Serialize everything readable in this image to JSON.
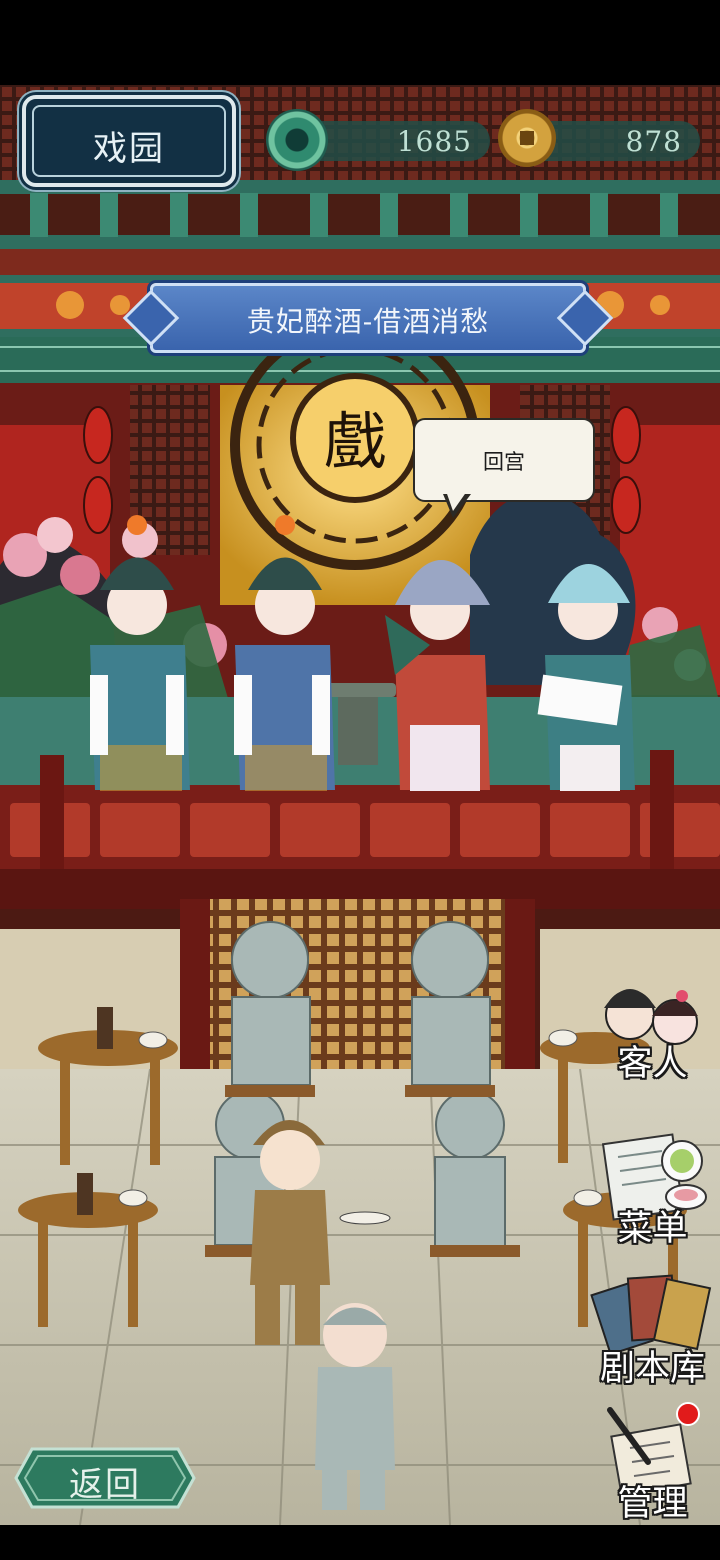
{
  "header": {
    "title": "戏园",
    "jade_amount": "1685",
    "coin_amount": "878"
  },
  "play_banner": "贵妃醉酒-借酒消愁",
  "stage": {
    "sign_char": "戲",
    "speech_bubble": "回宫"
  },
  "side_menu": [
    {
      "key": "guests",
      "label": "客人",
      "icon": "guests-portrait-icon"
    },
    {
      "key": "menu",
      "label": "菜单",
      "icon": "dishes-menu-icon"
    },
    {
      "key": "scripts",
      "label": "剧本库",
      "icon": "script-cards-icon"
    },
    {
      "key": "manage",
      "label": "管理",
      "icon": "scroll-brush-icon",
      "has_notification": true
    }
  ],
  "back_button": "返回",
  "colors": {
    "jade": "#2f8a6f",
    "stage_red": "#8e1f1b",
    "banner_blue": "#3a64ad",
    "notification": "#e11b1b"
  }
}
